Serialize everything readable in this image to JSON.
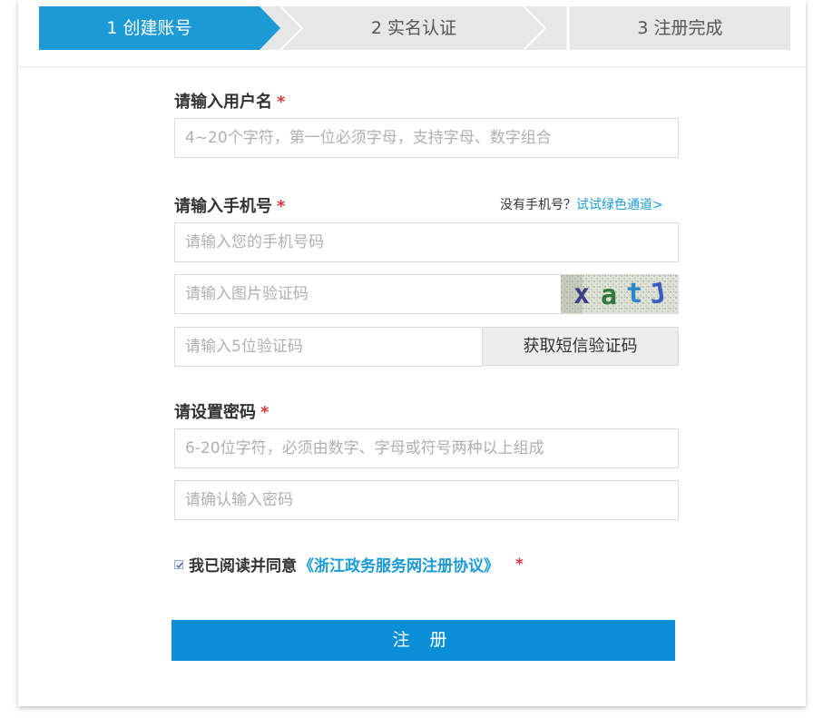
{
  "steps": [
    {
      "label": "1 创建账号",
      "active": true
    },
    {
      "label": "2 实名认证",
      "active": false
    },
    {
      "label": "3 注册完成",
      "active": false
    }
  ],
  "form": {
    "username": {
      "label": "请输入用户名",
      "required_mark": "*",
      "placeholder": "4~20个字符，第一位必须字母，支持字母、数字组合",
      "value": ""
    },
    "phone": {
      "label": "请输入手机号",
      "required_mark": "*",
      "placeholder": "请输入您的手机号码",
      "value": "",
      "no_phone_text": "没有手机号？",
      "green_channel_link": "试试绿色通道>"
    },
    "image_code": {
      "placeholder": "请输入图片验证码",
      "value": "",
      "captcha_text": "xatJ"
    },
    "sms_code": {
      "placeholder": "请输入5位验证码",
      "value": "",
      "button_label": "获取短信验证码"
    },
    "password": {
      "label": "请设置密码",
      "required_mark": "*",
      "placeholder": "6-20位字符，必须由数字、字母或符号两种以上组成",
      "value": ""
    },
    "confirm_password": {
      "placeholder": "请确认输入密码",
      "value": ""
    },
    "agreement": {
      "checked": true,
      "text": "我已阅读并同意",
      "link": "《浙江政务服务网注册协议》",
      "required_mark": "*"
    },
    "submit_label": "注 册"
  },
  "colors": {
    "accent": "#1b9ad6",
    "button": "#0a8fd6",
    "required": "#d9383a",
    "step_inactive": "#e7e7e7"
  }
}
